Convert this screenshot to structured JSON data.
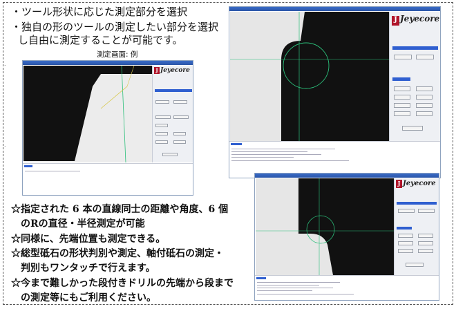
{
  "intro": {
    "line1": "・ツール形状に応じた測定部分を選択",
    "line2": "・独自の形のツールの測定したい部分を選択",
    "line3": "し自由に測定することが可能です。",
    "caption": "測定画面: 例"
  },
  "bullets": {
    "b1_line1": "☆指定された 6 本の直線同士の距離や角度、6 個",
    "b1_line2": "のRの直径・半径測定が可能",
    "b2_line1": "☆同様に、先端位置も測定できる。",
    "b3_line1": "☆総型砥石の形状判別や測定、軸付砥石の測定・",
    "b3_line2": "判別もワンタッチで行えます。",
    "b4_line1": "☆今まで難しかった段付きドリルの先端から段まで",
    "b4_line2": "の測定等にもご利用ください。"
  },
  "screens": {
    "logo_text": "Jeyecore",
    "logo_mark": "J"
  },
  "colors": {
    "tool_dark": "#111111",
    "measure_line": "#2bbf7a",
    "title_bar": "#2f5fd0",
    "logo_red": "#b0142a"
  }
}
